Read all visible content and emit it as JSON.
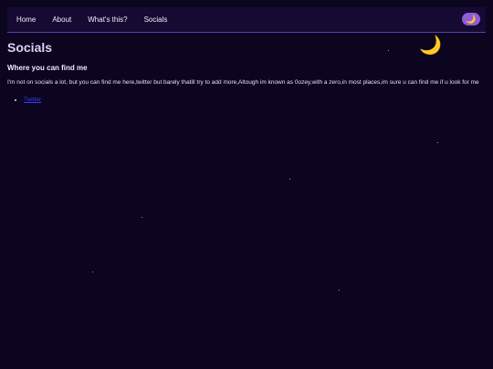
{
  "nav": {
    "items": [
      {
        "label": "Home"
      },
      {
        "label": "About"
      },
      {
        "label": "What's this?"
      },
      {
        "label": "Socials"
      }
    ],
    "theme_toggle_icon": "crescent-moon-icon"
  },
  "page": {
    "title": "Socials",
    "subtitle": "Where you can find me",
    "description": "I'm not on socials a lot, but you can find me here,twitter but barely thatill try to add more,Altough im known as 0ozey,with a zero,in most places,im sure u can find me if u look for me",
    "links": [
      {
        "label": "Twitter"
      }
    ],
    "decoration_icon": "crescent-moon-icon"
  },
  "colors": {
    "background": "#0b0520",
    "navbar": "#160a33",
    "accent": "#8f5bd8",
    "link": "#3b3bff"
  }
}
